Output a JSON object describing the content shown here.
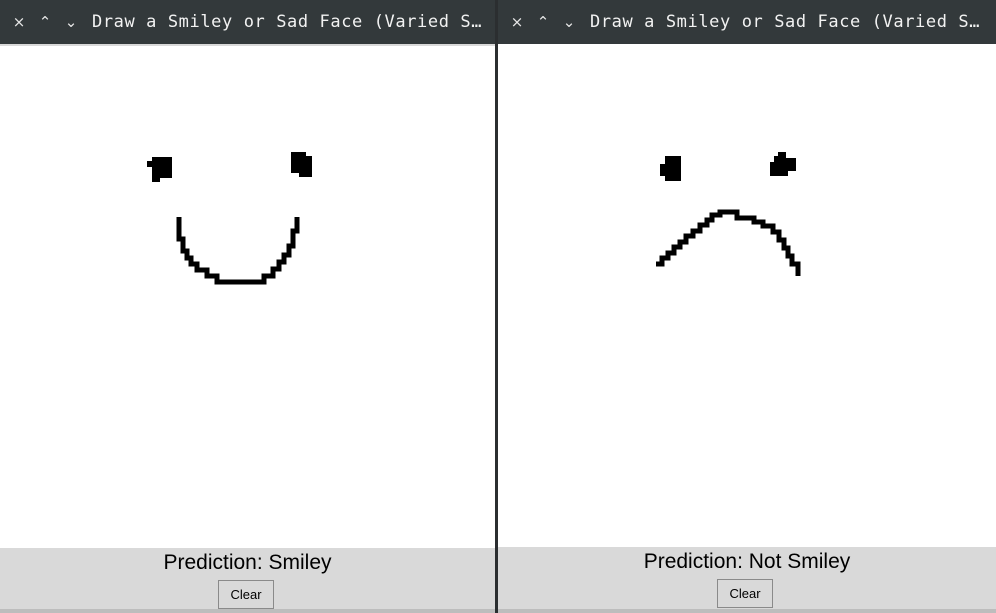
{
  "windows": [
    {
      "title": "Draw a Smiley or Sad Face (Varied Sizes and Positions)",
      "prediction": "Prediction: Smiley",
      "clear_label": "Clear"
    },
    {
      "title": "Draw a Smiley or Sad Face (Varied Sizes and Positions)",
      "prediction": "Prediction: Not Smiley",
      "clear_label": "Clear"
    }
  ],
  "titlebar_controls": {
    "close": "×",
    "maximize": "⌃",
    "minimize": "⌄"
  },
  "colors": {
    "titlebar": "#33393b",
    "canvas": "#ffffff",
    "panel": "#d9d9d9",
    "ink": "#000000"
  }
}
